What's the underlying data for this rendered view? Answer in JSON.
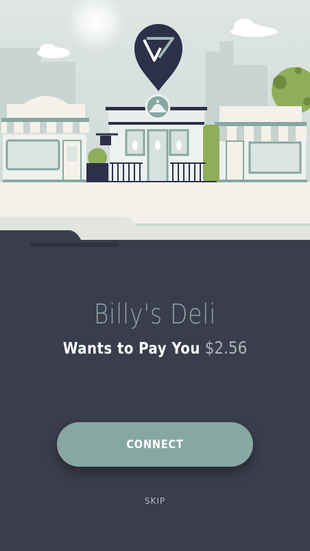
{
  "merchant": {
    "name": "Billy's Deli",
    "request_label": "Wants to Pay You",
    "amount": "$2.56"
  },
  "actions": {
    "connect_label": "CONNECT",
    "skip_label": "SKIP"
  },
  "icons": {
    "pin": "location-pin-icon",
    "logo": "v-logo-icon",
    "cloche": "cloche-icon"
  },
  "colors": {
    "background": "#3a3d4b",
    "accent": "#87a7a3",
    "title": "#8fa8a4",
    "pin": "#2c3149"
  }
}
